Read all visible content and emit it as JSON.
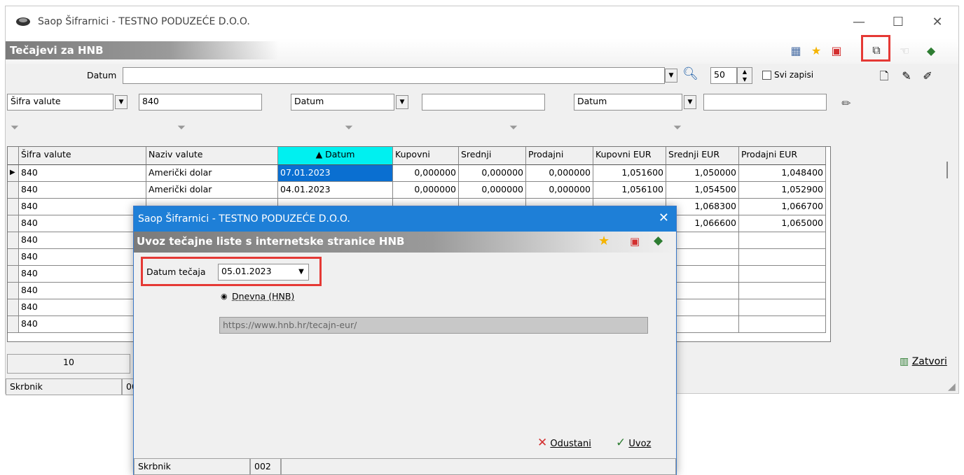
{
  "main": {
    "title": "Saop Šifrarnici - TESTNO PODUZEĆE D.O.O.",
    "subtitle": "Tečajevi za HNB",
    "window_controls": {
      "minimize": "—",
      "maximize": "☐",
      "close": "✕"
    },
    "filter": {
      "datum_label": "Datum",
      "datum_value": "",
      "limit": "50",
      "svi_zapisi": "Svi zapisi",
      "f1_field": "Šifra valute",
      "f1_value": "840",
      "f2_field": "Datum",
      "f2_value": "",
      "f3_field": "Datum",
      "f3_value": ""
    },
    "grid": {
      "columns": [
        "Šifra valute",
        "Naziv valute",
        "▲ Datum",
        "Kupovni",
        "Srednji",
        "Prodajni",
        "Kupovni EUR",
        "Srednji EUR",
        "Prodajni EUR"
      ],
      "rows": [
        [
          "840",
          "Američki dolar",
          "07.01.2023",
          "0,000000",
          "0,000000",
          "0,000000",
          "1,051600",
          "1,050000",
          "1,048400"
        ],
        [
          "840",
          "Američki dolar",
          "04.01.2023",
          "0,000000",
          "0,000000",
          "0,000000",
          "1,056100",
          "1,054500",
          "1,052900"
        ],
        [
          "840",
          "",
          "",
          "",
          "",
          "",
          "",
          "1,068300",
          "1,066700"
        ],
        [
          "840",
          "",
          "",
          "",
          "",
          "",
          "",
          "1,066600",
          "1,065000"
        ],
        [
          "840",
          "",
          "",
          "",
          "",
          "",
          "",
          "",
          ""
        ],
        [
          "840",
          "",
          "",
          "",
          "",
          "",
          "",
          "",
          ""
        ],
        [
          "840",
          "",
          "",
          "",
          "",
          "",
          "",
          "",
          ""
        ],
        [
          "840",
          "",
          "",
          "",
          "",
          "",
          "",
          "",
          ""
        ],
        [
          "840",
          "",
          "",
          "",
          "",
          "",
          "",
          "",
          ""
        ],
        [
          "840",
          "",
          "",
          "",
          "",
          "",
          "",
          "",
          ""
        ]
      ]
    },
    "record_count": "10",
    "close_button": "Zatvori",
    "status": {
      "user": "Skrbnik",
      "code": "00"
    }
  },
  "dialog": {
    "title": "Saop Šifrarnici - TESTNO PODUZEĆE D.O.O.",
    "close": "✕",
    "subtitle": "Uvoz tečajne liste s internetske stranice HNB",
    "date_label": "Datum tečaja",
    "date_value": "05.01.2023",
    "radio_label": "Dnevna (HNB)",
    "url": "https://www.hnb.hr/tecajn-eur/",
    "cancel": "Odustani",
    "import": "Uvoz",
    "status": {
      "user": "Skrbnik",
      "code": "002"
    }
  },
  "colors": {
    "accent": "#1e7fd7",
    "highlight": "#e53935",
    "header_selected": "#00f0f0",
    "cell_selected": "#0a6fd1"
  }
}
